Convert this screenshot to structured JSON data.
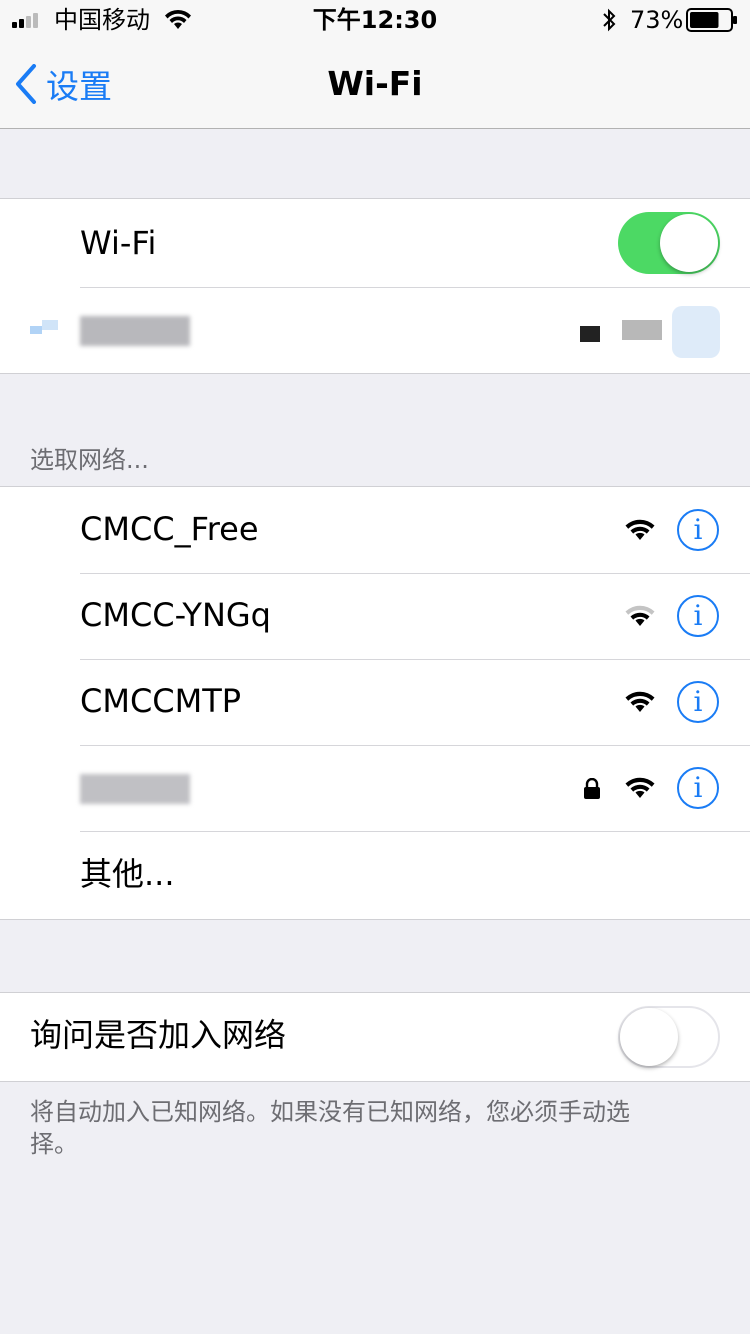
{
  "status_bar": {
    "carrier": "中国移动",
    "time": "下午12:30",
    "battery_percent": "73%",
    "battery_level": 0.73,
    "icons": [
      "signal-icon",
      "wifi-icon",
      "bluetooth-icon",
      "battery-icon"
    ]
  },
  "nav": {
    "back_label": "设置",
    "title": "Wi-Fi"
  },
  "wifi_toggle": {
    "label": "Wi-Fi",
    "state": "on"
  },
  "connected_network": {
    "name": ""
  },
  "networks_section": {
    "header": "选取网络...",
    "networks": [
      {
        "name": "CMCC_Free",
        "secured": false,
        "signal": "full"
      },
      {
        "name": "CMCC-YNGq",
        "secured": false,
        "signal": "weak"
      },
      {
        "name": "CMCCMTP",
        "secured": false,
        "signal": "full"
      },
      {
        "name": "",
        "secured": true,
        "signal": "full"
      }
    ],
    "other_label": "其他..."
  },
  "ask_to_join": {
    "label": "询问是否加入网络",
    "state": "off",
    "footer": "将自动加入已知网络。如果没有已知网络，您必须手动选择。"
  },
  "colors": {
    "accent": "#1a7cf5",
    "toggle_on": "#4cd964",
    "background": "#efeff4"
  }
}
